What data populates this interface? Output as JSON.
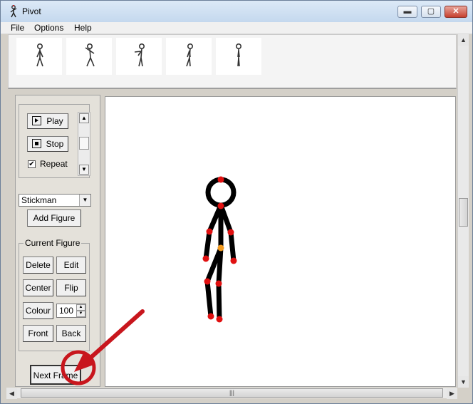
{
  "window": {
    "title": "Pivot",
    "min_glyph": "▬",
    "max_glyph": "▢",
    "close_glyph": "✕"
  },
  "menu": [
    "File",
    "Options",
    "Help"
  ],
  "frames": [
    {
      "pose": "standing"
    },
    {
      "pose": "waving"
    },
    {
      "pose": "pointing"
    },
    {
      "pose": "walking"
    },
    {
      "pose": "side"
    }
  ],
  "controls": {
    "play_label": "Play",
    "stop_label": "Stop",
    "repeat_label": "Repeat",
    "repeat_checked": true,
    "repeat_mark": "✔",
    "speed_up": "▲",
    "speed_down": "▼"
  },
  "figure_select": {
    "value": "Stickman",
    "arrow": "▼"
  },
  "add_figure_label": "Add Figure",
  "current_figure": {
    "legend": "Current Figure",
    "delete_label": "Delete",
    "edit_label": "Edit",
    "center_label": "Center",
    "flip_label": "Flip",
    "colour_label": "Colour",
    "size_value": "100",
    "front_label": "Front",
    "back_label": "Back"
  },
  "next_frame_label": "Next Frame",
  "scroll": {
    "up": "▲",
    "down": "▼",
    "left": "◀",
    "right": "▶",
    "grip": "|||"
  },
  "colors": {
    "joint": "#e01010",
    "center_joint": "#f29a1e",
    "annotation": "#c8161d",
    "figure": "#000000"
  }
}
